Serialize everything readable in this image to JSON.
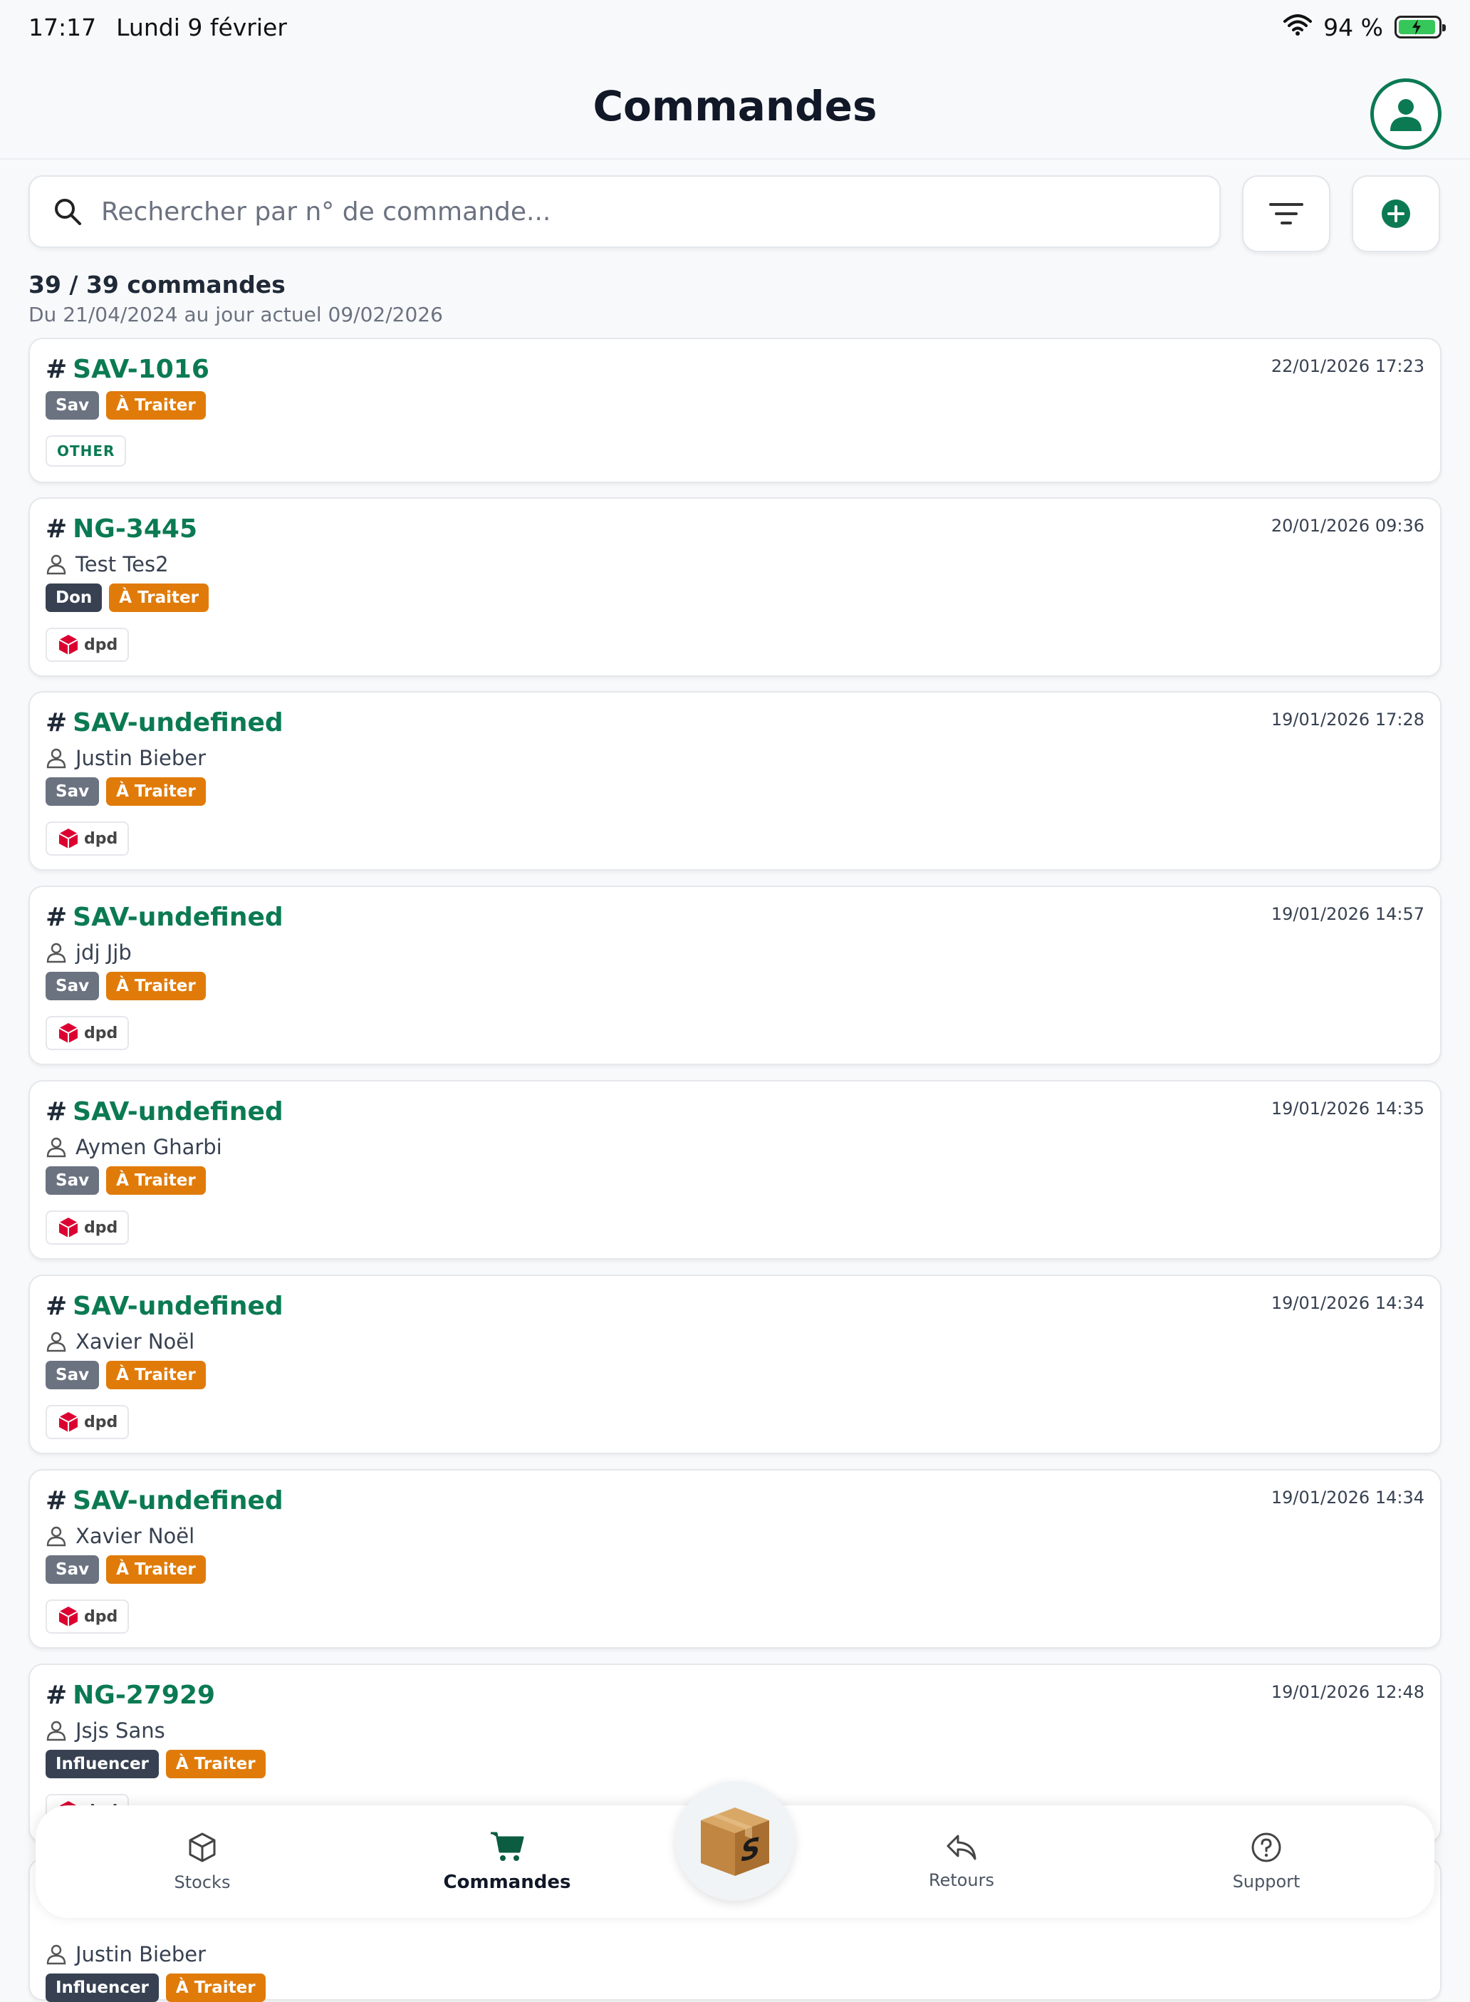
{
  "status_bar": {
    "time": "17:17",
    "date": "Lundi 9 février",
    "battery": "94 %"
  },
  "header": {
    "title": "Commandes"
  },
  "search": {
    "placeholder": "Rechercher par n° de commande..."
  },
  "summary": {
    "count": "39 / 39 commandes",
    "range": "Du 21/04/2024 au jour actuel 09/02/2026"
  },
  "orders": [
    {
      "id": "SAV-1016",
      "date": "22/01/2026 17:23",
      "customer": "",
      "tags": [
        "Sav",
        "À Traiter"
      ],
      "carrier": "OTHER"
    },
    {
      "id": "NG-3445",
      "date": "20/01/2026 09:36",
      "customer": "Test Tes2",
      "tags": [
        "Don",
        "À Traiter"
      ],
      "carrier": "dpd"
    },
    {
      "id": "SAV-undefined",
      "date": "19/01/2026 17:28",
      "customer": "Justin Bieber",
      "tags": [
        "Sav",
        "À Traiter"
      ],
      "carrier": "dpd"
    },
    {
      "id": "SAV-undefined",
      "date": "19/01/2026 14:57",
      "customer": "jdj Jjb",
      "tags": [
        "Sav",
        "À Traiter"
      ],
      "carrier": "dpd"
    },
    {
      "id": "SAV-undefined",
      "date": "19/01/2026 14:35",
      "customer": "Aymen Gharbi",
      "tags": [
        "Sav",
        "À Traiter"
      ],
      "carrier": "dpd"
    },
    {
      "id": "SAV-undefined",
      "date": "19/01/2026 14:34",
      "customer": "Xavier Noël",
      "tags": [
        "Sav",
        "À Traiter"
      ],
      "carrier": "dpd"
    },
    {
      "id": "SAV-undefined",
      "date": "19/01/2026 14:34",
      "customer": "Xavier Noël",
      "tags": [
        "Sav",
        "À Traiter"
      ],
      "carrier": "dpd"
    },
    {
      "id": "NG-27929",
      "date": "19/01/2026 12:48",
      "customer": "Jsjs Sans",
      "tags": [
        "Influencer",
        "À Traiter"
      ],
      "carrier": "dpd"
    },
    {
      "id": "",
      "date": "",
      "customer": "Justin  Bieber",
      "tags": [
        "Influencer",
        "À Traiter"
      ],
      "carrier": ""
    }
  ],
  "nav": {
    "stocks": "Stocks",
    "orders": "Commandes",
    "returns": "Retours",
    "support": "Support",
    "center_icon": "box-logo-icon"
  },
  "colors": {
    "brand_green": "#0b7a53",
    "status_orange": "#e07b0a",
    "tag_gray": "#6b7280",
    "tag_dark": "#374151"
  }
}
